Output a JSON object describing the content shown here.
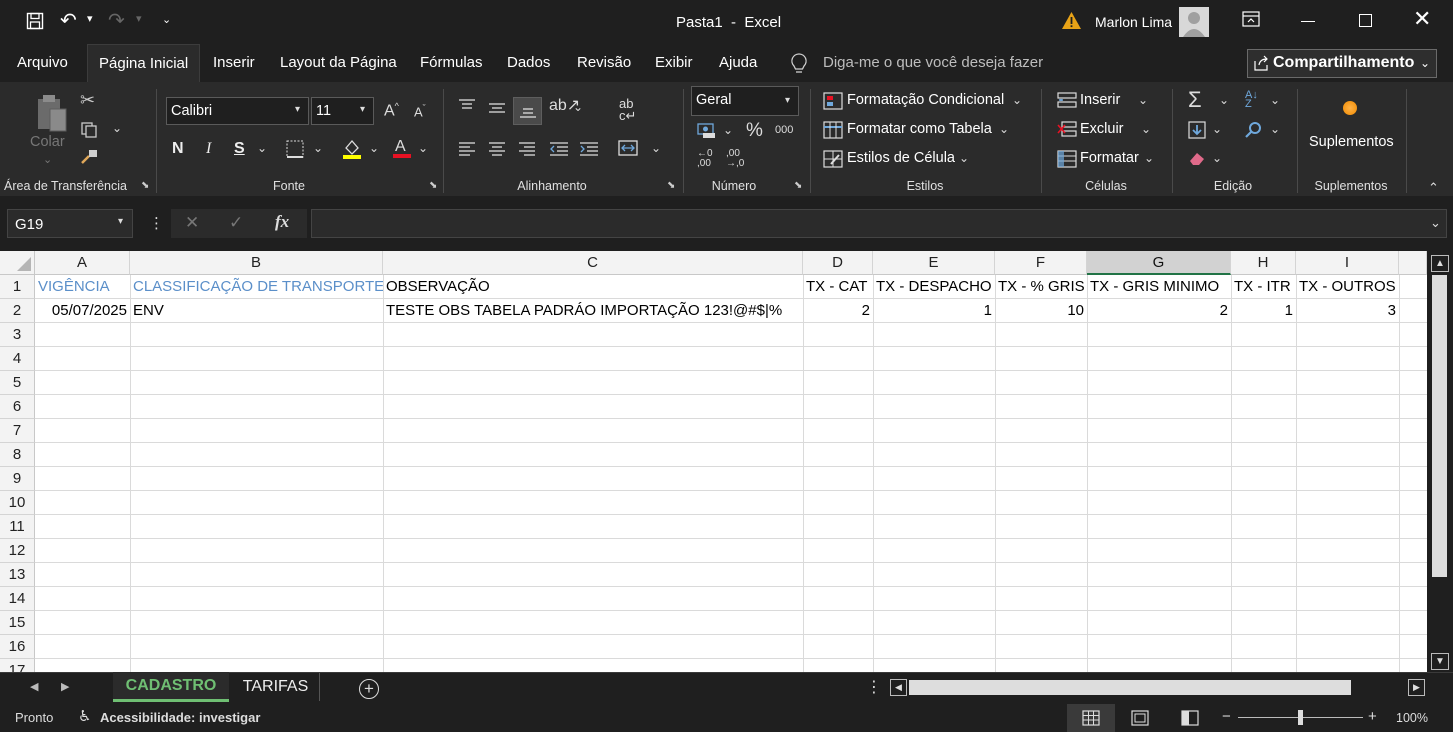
{
  "window": {
    "title": "Pasta1  -  Excel",
    "user": "Marlon Lima"
  },
  "tabs": [
    "Arquivo",
    "Página Inicial",
    "Inserir",
    "Layout da Página",
    "Fórmulas",
    "Dados",
    "Revisão",
    "Exibir",
    "Ajuda"
  ],
  "tell_me": "Diga-me o que você deseja fazer",
  "share_label": "Compartilhamento",
  "ribbon": {
    "clipboard": {
      "paste": "Colar",
      "label": "Área de Transferência"
    },
    "font": {
      "name": "Calibri",
      "size": "11",
      "bold": "N",
      "italic": "I",
      "underline": "S",
      "label": "Fonte"
    },
    "alignment": {
      "label": "Alinhamento"
    },
    "number": {
      "format": "Geral",
      "percent": "%",
      "thousands": "000",
      "label": "Número"
    },
    "styles": {
      "cond": "Formatação Condicional",
      "table": "Formatar como Tabela",
      "cell": "Estilos de Célula",
      "label": "Estilos"
    },
    "cells": {
      "insert": "Inserir",
      "delete": "Excluir",
      "format": "Formatar",
      "label": "Células"
    },
    "editing": {
      "label": "Edição"
    },
    "addins": {
      "button": "Suplementos",
      "label": "Suplementos"
    }
  },
  "name_box": "G19",
  "formula_fx": "fx",
  "columns": [
    "A",
    "B",
    "C",
    "D",
    "E",
    "F",
    "G",
    "H",
    "I"
  ],
  "rows": [
    "1",
    "2",
    "3",
    "4",
    "5",
    "6",
    "7",
    "8",
    "9",
    "10",
    "11",
    "12",
    "13",
    "14",
    "15",
    "16",
    "17"
  ],
  "cells": {
    "r1": [
      "VIGÊNCIA",
      "CLASSIFICAÇÃO DE TRANSPORTE",
      "OBSERVAÇÃO",
      "TX - CAT",
      "TX - DESPACHO",
      "TX - % GRIS",
      "TX - GRIS MINIMO",
      "TX - ITR",
      "TX - OUTROS"
    ],
    "r2": [
      "05/07/2025",
      "ENV",
      "TESTE OBS TABELA PADRÁO IMPORTAÇÃO 123!@#$|%",
      "2",
      "1",
      "10",
      "2",
      "1",
      "3"
    ]
  },
  "sheets": [
    "CADASTRO",
    "TARIFAS"
  ],
  "status": {
    "ready": "Pronto",
    "accessibility": "Acessibilidade: investigar",
    "zoom": "100%"
  },
  "colors": {
    "accent": "#217346",
    "header_blue": "#5b8fc9",
    "warning": "#e8a317"
  }
}
